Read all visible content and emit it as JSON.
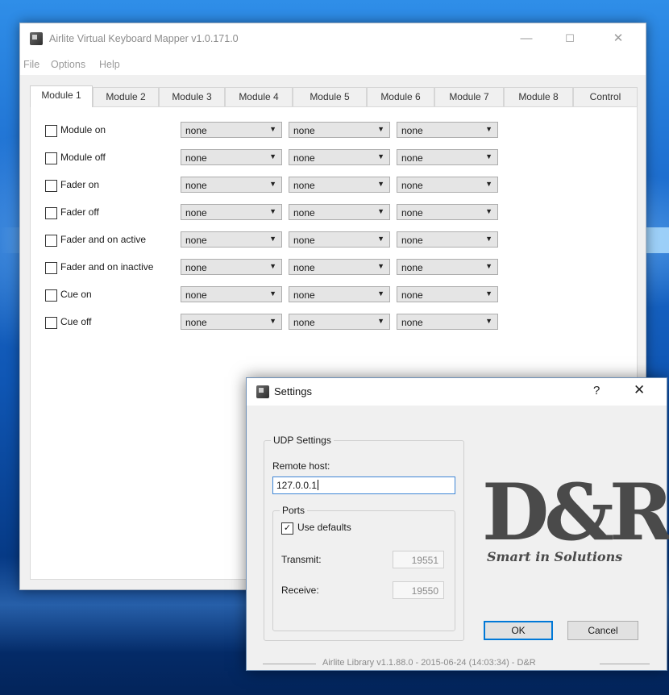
{
  "window": {
    "title": "Airlite Virtual Keyboard Mapper v1.0.171.0",
    "minimize": "—",
    "maximize": "☐",
    "close": "✕"
  },
  "menu": [
    "File",
    "Options",
    "Help"
  ],
  "tabs": [
    "Module 1",
    "Module 2",
    "Module 3",
    "Module 4",
    "Module 5",
    "Module 6",
    "Module 7",
    "Module 8",
    "Control"
  ],
  "active_tab": "Module 1",
  "rows": [
    {
      "label": "Module on",
      "checked": false,
      "selects": [
        "none",
        "none",
        "none"
      ]
    },
    {
      "label": "Module off",
      "checked": false,
      "selects": [
        "none",
        "none",
        "none"
      ]
    },
    {
      "label": "Fader on",
      "checked": false,
      "selects": [
        "none",
        "none",
        "none"
      ]
    },
    {
      "label": "Fader off",
      "checked": false,
      "selects": [
        "none",
        "none",
        "none"
      ]
    },
    {
      "label": "Fader and on active",
      "checked": false,
      "selects": [
        "none",
        "none",
        "none"
      ]
    },
    {
      "label": "Fader and on inactive",
      "checked": false,
      "selects": [
        "none",
        "none",
        "none"
      ]
    },
    {
      "label": "Cue on",
      "checked": false,
      "selects": [
        "none",
        "none",
        "none"
      ]
    },
    {
      "label": "Cue off",
      "checked": false,
      "selects": [
        "none",
        "none",
        "none"
      ]
    }
  ],
  "dialog": {
    "title": "Settings",
    "help": "?",
    "close": "✕",
    "udp_group": "UDP Settings",
    "remote_host_label": "Remote host:",
    "remote_host_value": "127.0.0.1",
    "ports_group": "Ports",
    "use_defaults_label": "Use defaults",
    "use_defaults_checked": true,
    "check_glyph": "✓",
    "transmit_label": "Transmit:",
    "transmit_value": "19551",
    "receive_label": "Receive:",
    "receive_value": "19550",
    "ok_label": "OK",
    "cancel_label": "Cancel",
    "logo_text": "D&R",
    "logo_tagline": "Smart in Solutions",
    "footer": "Airlite Library v1.1.88.0 - 2015-06-24 (14:03:34) - D&R"
  },
  "colors": {
    "accent": "#0078d7",
    "desktop": "#1e6fd0",
    "logo": "#4a4a4a"
  }
}
